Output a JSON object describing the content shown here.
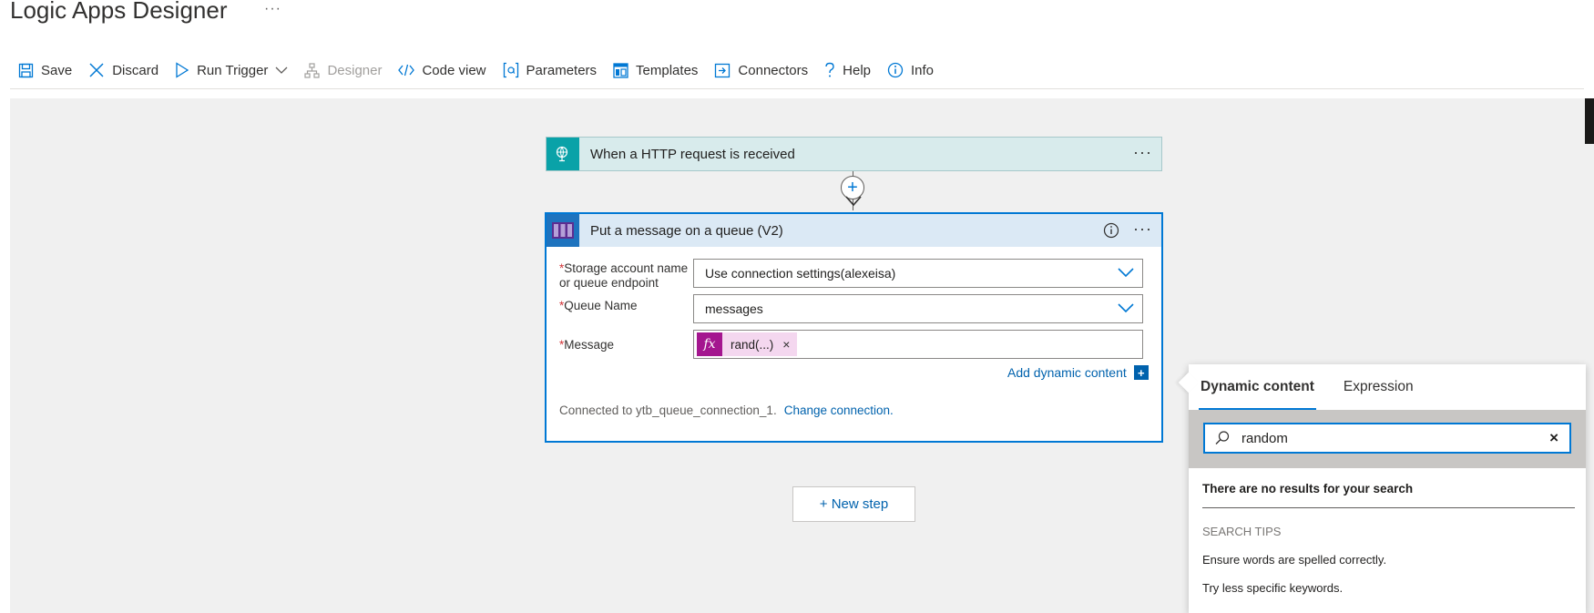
{
  "header": {
    "title": "Logic Apps Designer",
    "more": "···"
  },
  "toolbar": {
    "save": "Save",
    "discard": "Discard",
    "run_trigger": "Run Trigger",
    "designer": "Designer",
    "code_view": "Code view",
    "parameters": "Parameters",
    "templates": "Templates",
    "connectors": "Connectors",
    "help": "Help",
    "info": "Info"
  },
  "trigger": {
    "title": "When a HTTP request is received",
    "more": "···"
  },
  "action": {
    "title": "Put a message on a queue (V2)",
    "more": "···",
    "fields": {
      "storage": {
        "label": "Storage account name or queue endpoint",
        "value": "Use connection settings(alexeisa)"
      },
      "queue": {
        "label": "Queue Name",
        "value": "messages"
      },
      "message": {
        "label": "Message",
        "token_fx": "fx",
        "token": "rand(...)",
        "token_remove": "×"
      }
    },
    "required_mark": "*",
    "add_dynamic": "Add dynamic content",
    "add_dynamic_icon": "+",
    "connected_text": "Connected to ytb_queue_connection_1.",
    "change_connection": "Change connection."
  },
  "new_step": "+ New step",
  "plus": "+",
  "dynamic_panel": {
    "tabs": [
      "Dynamic content",
      "Expression"
    ],
    "search_value": "random",
    "clear": "×",
    "no_results": "There are no results for your search",
    "tips_heading": "SEARCH TIPS",
    "tips": [
      "Ensure words are spelled correctly.",
      "Try less specific keywords."
    ]
  },
  "colors": {
    "accent": "#0078d4",
    "trigger": "#0aa2a8",
    "action_icon": "#1e73be",
    "token": "#a4168f"
  }
}
